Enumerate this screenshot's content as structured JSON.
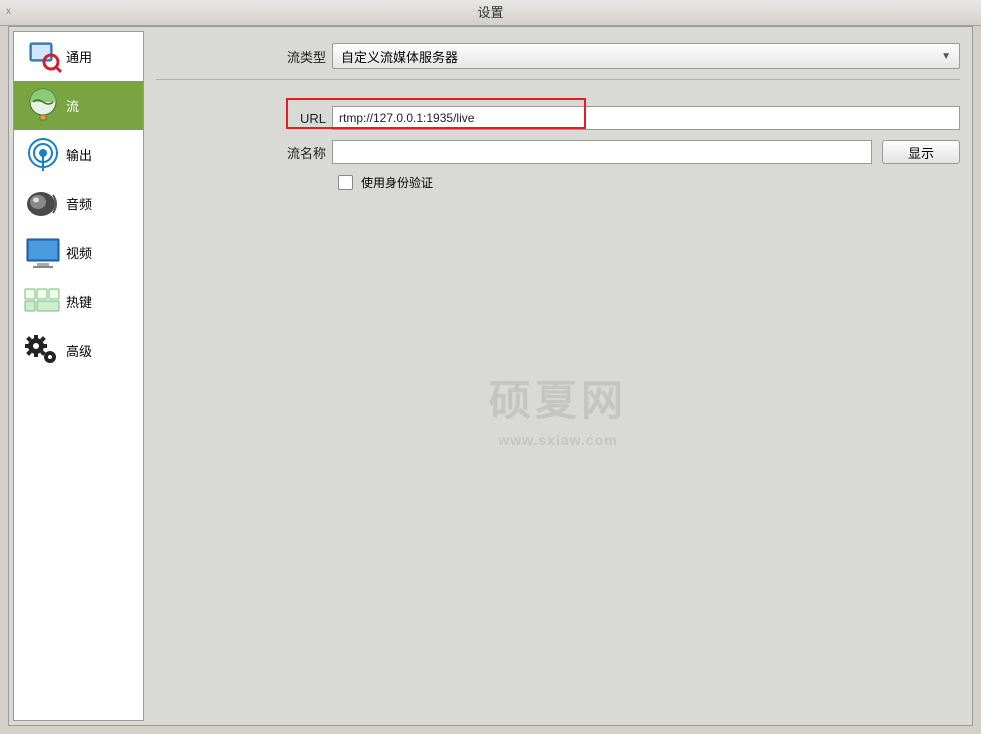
{
  "window": {
    "title": "设置",
    "close": "x"
  },
  "sidebar": {
    "items": [
      {
        "label": "通用"
      },
      {
        "label": "流"
      },
      {
        "label": "输出"
      },
      {
        "label": "音频"
      },
      {
        "label": "视频"
      },
      {
        "label": "热键"
      },
      {
        "label": "高级"
      }
    ]
  },
  "form": {
    "stream_type_label": "流类型",
    "stream_type_value": "自定义流媒体服务器",
    "url_label": "URL",
    "url_value": "rtmp://127.0.0.1:1935/live",
    "stream_key_label": "流名称",
    "stream_key_value": "",
    "show_button": "显示",
    "auth_checkbox_label": "使用身份验证"
  },
  "watermark": {
    "main": "硕夏网",
    "sub": "www.sxiaw.com"
  }
}
